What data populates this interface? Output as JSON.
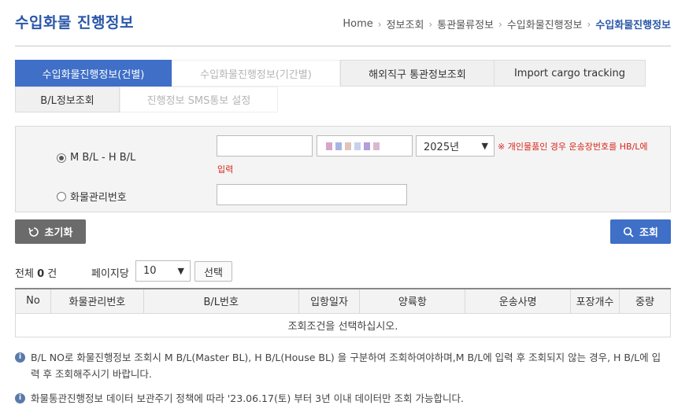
{
  "page": {
    "title": "수입화물 진행정보"
  },
  "breadcrumb": {
    "items": [
      "Home",
      "정보조회",
      "통관물류정보",
      "수입화물진행정보"
    ],
    "current": "수입화물진행정보"
  },
  "tabs": {
    "row1": [
      {
        "label": "수입화물진행정보(건별)",
        "state": "active"
      },
      {
        "label": "수입화물진행정보(기간별)",
        "state": "disabled"
      },
      {
        "label": "해외직구 통관정보조회",
        "state": "normal"
      },
      {
        "label": "Import cargo tracking",
        "state": "normal"
      }
    ],
    "row2": [
      {
        "label": "B/L정보조회",
        "state": "normal"
      },
      {
        "label": "진행정보 SMS통보 설정",
        "state": "disabled"
      }
    ]
  },
  "search": {
    "radio_mbl_hbl": "M B/L - H B/L",
    "radio_cargo_no": "화물관리번호",
    "mbl_value": "",
    "hbl_value": "",
    "year_selected": "2025년",
    "notice_line1": "※ 개인물품인 경우 운송장번호를 HB/L에",
    "notice_line2": "입력",
    "cargo_no_value": ""
  },
  "buttons": {
    "reset": "초기화",
    "search": "조회",
    "select": "선택"
  },
  "summary": {
    "total_prefix": "전체",
    "total_count": "0",
    "total_suffix": "건",
    "per_page_label": "페이지당",
    "per_page_value": "10"
  },
  "table": {
    "headers": [
      "No",
      "화물관리번호",
      "B/L번호",
      "입항일자",
      "양륙항",
      "운송사명",
      "포장개수",
      "중량"
    ],
    "empty_message": "조회조건을 선택하십시오."
  },
  "info": {
    "line1": "B/L NO로 화물진행정보 조회시 M B/L(Master BL), H B/L(House BL) 을 구분하여 조회하여야하며,M B/L에 입력 후 조회되지 않는 경우, H B/L에 입력 후 조회해주시기 바랍니다.",
    "line2": "화물통관진행정보 데이터 보관주기 정책에 따라 '23.06.17(토) 부터 3년 이내 데이터만 조회 가능합니다."
  },
  "colors": {
    "accent": "#3f6fc7",
    "title": "#2a57a8",
    "notice": "#d9261c",
    "reset_button": "#6b6b6b"
  }
}
